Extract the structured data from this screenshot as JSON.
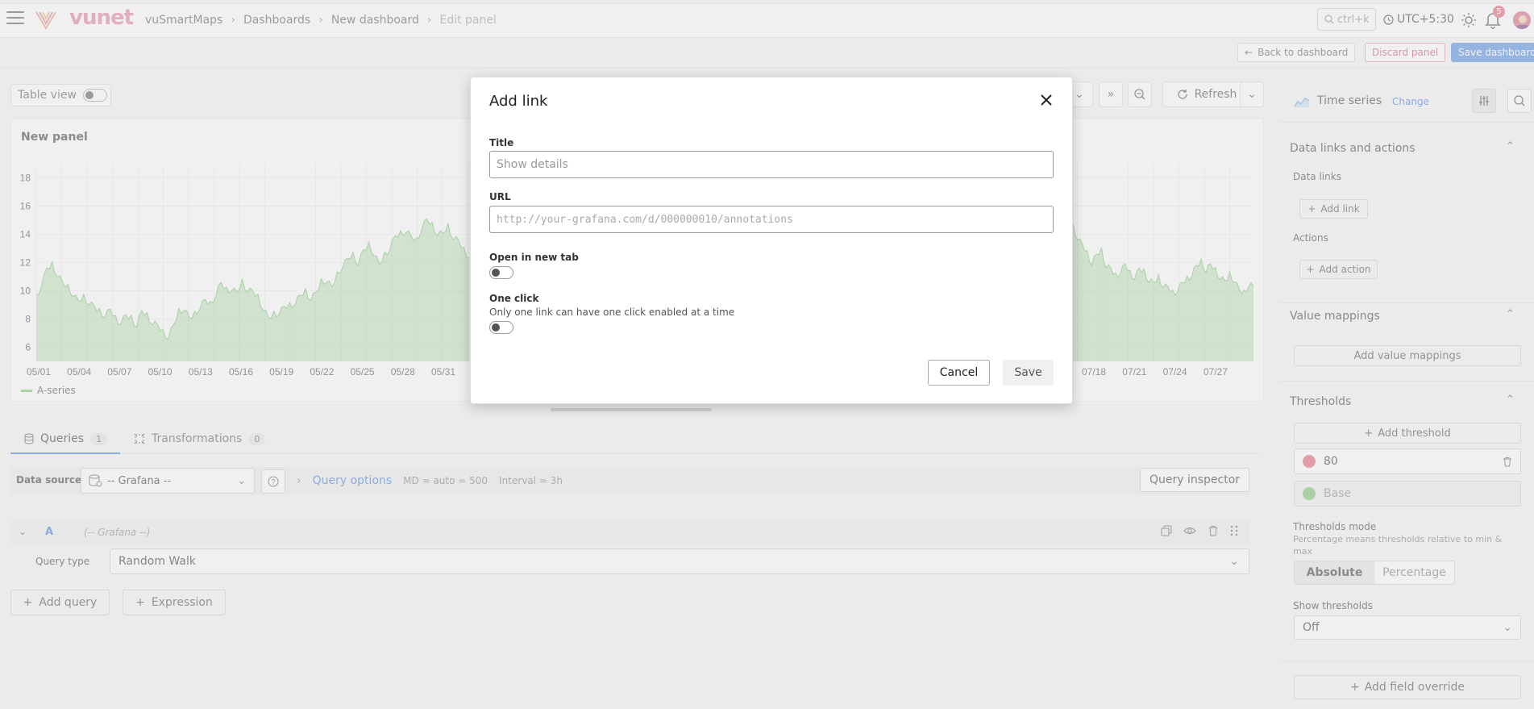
{
  "brand": {
    "logo_text": "vunet"
  },
  "breadcrumbs": [
    "vuSmartMaps",
    "Dashboards",
    "New dashboard",
    "Edit panel"
  ],
  "topbar": {
    "search_hint": "ctrl+k",
    "timezone": "UTC+5:30",
    "notification_count": "5"
  },
  "actions": {
    "back": "Back to dashboard",
    "discard": "Discard panel",
    "save": "Save dashboard"
  },
  "toolbar": {
    "table_view": "Table view",
    "refresh": "Refresh"
  },
  "panel": {
    "title": "New panel",
    "legend": "A-series"
  },
  "chart_data": {
    "type": "area",
    "yticks": [
      "18",
      "16",
      "14",
      "12",
      "10",
      "8",
      "6"
    ],
    "xticks_left": [
      "05/01",
      "05/04",
      "05/07",
      "05/10",
      "05/13",
      "05/16",
      "05/19",
      "05/22",
      "05/25",
      "05/28",
      "05/31"
    ],
    "xticks_right": [
      "07/18",
      "07/21",
      "07/24",
      "07/27"
    ],
    "ylim": [
      5,
      19
    ],
    "series": [
      {
        "name": "A-series",
        "color": "#73bf69"
      }
    ],
    "values_left": [
      9.5,
      10.5,
      11.5,
      11.8,
      11.2,
      10.5,
      10.2,
      9.8,
      9.2,
      9.5,
      9.2,
      8.8,
      8.5,
      8.3,
      8.6,
      8.0,
      7.8,
      8.2,
      8.0,
      7.6,
      8.5,
      8.2,
      7.8,
      7.5,
      7.0,
      6.8,
      7.5,
      8.5,
      8.8,
      8.0,
      8.3,
      8.9,
      9.3,
      9.0,
      9.8,
      10.5,
      10.0,
      10.2,
      9.8,
      10.6,
      10.1,
      9.9,
      9.5,
      8.8,
      8.0,
      8.3,
      8.5,
      8.8,
      8.9,
      9.2,
      9.6,
      9.9,
      9.5,
      9.8,
      10.6,
      10.8,
      10.2,
      11.1,
      11.8,
      12.2,
      12.5,
      12.0,
      12.8,
      13.2,
      12.7,
      11.8,
      12.5,
      13.1,
      13.8,
      14.0,
      14.3,
      13.8,
      13.5,
      14.5,
      15.0,
      14.6,
      14.1,
      14.0,
      14.5,
      13.8,
      13.5,
      12.8,
      12.5
    ],
    "values_right": [
      14.5,
      13.8,
      13.2,
      12.6,
      12.0,
      12.5,
      12.8,
      11.8,
      11.5,
      11.0,
      11.4,
      11.8,
      11.2,
      11.0,
      11.5,
      11.3,
      10.8,
      10.5,
      10.9,
      10.4,
      10.2,
      9.8,
      10.1,
      10.5,
      10.8,
      11.2,
      11.7,
      12.0,
      11.5,
      11.8,
      11.4,
      11.0,
      10.6,
      11.1,
      10.8,
      10.0,
      9.8,
      10.5,
      10.2
    ]
  },
  "query_tabs": {
    "queries": "Queries",
    "queries_count": "1",
    "transformations": "Transformations",
    "transformations_count": "0"
  },
  "query_bar": {
    "ds_label": "Data source",
    "ds_value": "-- Grafana --",
    "options": "Query options",
    "md": "MD = auto = 500",
    "interval": "Interval = 3h",
    "inspector": "Query inspector"
  },
  "query_row": {
    "ref": "A",
    "ds": "(-- Grafana --)",
    "type_label": "Query type",
    "type_value": "Random Walk",
    "add_query": "Add query",
    "expression": "Expression"
  },
  "right": {
    "viz": "Time series",
    "change": "Change",
    "links_section": "Data links and actions",
    "data_links": "Data links",
    "add_link": "Add link",
    "actions": "Actions",
    "add_action": "Add action",
    "value_mappings": "Value mappings",
    "add_value_mappings": "Add value mappings",
    "thresholds": "Thresholds",
    "add_threshold": "Add threshold",
    "thr_value": "80",
    "thr_base": "Base",
    "thr_red": "#e05a6e",
    "thr_green": "#73bf69",
    "thr_mode": "Thresholds mode",
    "thr_mode_desc": "Percentage means thresholds relative to min &",
    "thr_mode_desc2": "max",
    "absolute": "Absolute",
    "percentage": "Percentage",
    "show_thr": "Show thresholds",
    "show_thr_val": "Off",
    "add_override": "Add field override"
  },
  "modal": {
    "title": "Add link",
    "title_label": "Title",
    "title_placeholder": "Show details",
    "url_label": "URL",
    "url_placeholder": "http://your-grafana.com/d/000000010/annotations",
    "new_tab": "Open in new tab",
    "one_click": "One click",
    "one_click_desc": "Only one link can have one click enabled at a time",
    "cancel": "Cancel",
    "save": "Save"
  }
}
